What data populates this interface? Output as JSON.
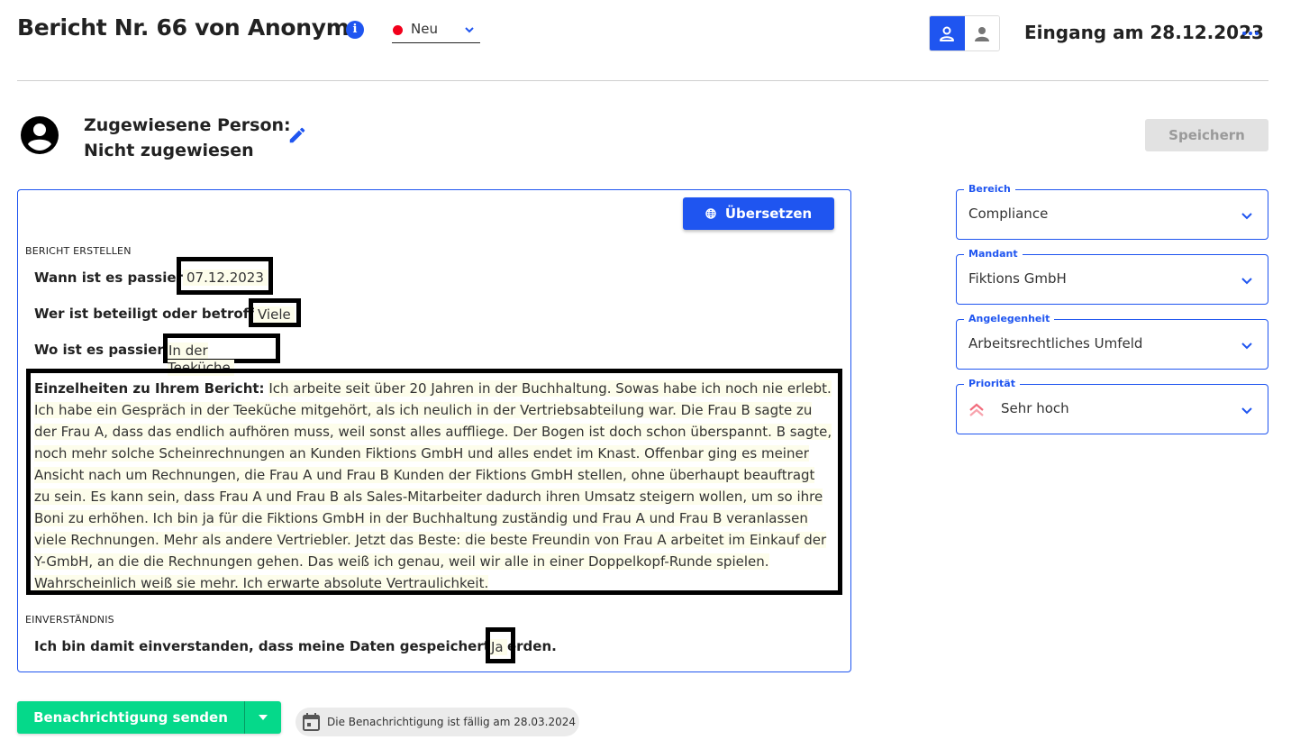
{
  "header": {
    "title": "Bericht Nr. 66 von Anonym",
    "info_icon": "info-icon",
    "status": {
      "label": "Neu",
      "color": "#f2001b"
    },
    "view_toggle": {
      "active": "person-outline-icon",
      "inactive": "person-filled-icon"
    },
    "received": "Eingang am 28.12.2023",
    "more_icon": "more-horizontal-icon"
  },
  "assignment": {
    "label_line1": "Zugewiesene Person:",
    "label_line2": "Nicht zugewiesen",
    "icon": "account-circle-icon",
    "edit_icon": "pencil-icon"
  },
  "toolbar": {
    "save_label": "Speichern",
    "translate_label": "Übersetzen"
  },
  "report": {
    "section_create": "BERICHT ERSTELLEN",
    "fields": [
      {
        "question": "Wann ist es passiert?",
        "answer": "07.12.2023"
      },
      {
        "question": "Wer ist beteiligt oder betroffen?",
        "answer": "Viele"
      },
      {
        "question": "Wo ist es passiert?:",
        "answer": "In der Teeküche"
      }
    ],
    "details_label": "Einzelheiten zu Ihrem Bericht:",
    "details_text": "Ich arbeite seit über 20 Jahren in der Buchhaltung. Sowas habe ich noch nie erlebt. Ich habe ein Gespräch in der Teeküche mitgehört, als ich neulich in der Vertriebsabteilung war. Die Frau B sagte zu der Frau A, dass das endlich aufhören muss, weil sonst alles auffliege. Der Bogen ist doch schon überspannt. B sagte, noch mehr solche Scheinrechnungen an Kunden Fiktions GmbH und alles endet im Knast. Offenbar ging es meiner Ansicht nach um Rechnungen, die Frau A und Frau B Kunden der Fiktions GmbH stellen, ohne überhaupt beauftragt zu sein. Es kann sein, dass Frau A und Frau B als Sales-Mitarbeiter dadurch ihren Umsatz steigern wollen, um so ihre Boni zu erhöhen. Ich bin ja für die Fiktions GmbH in der Buchhaltung zuständig und Frau A und Frau B veranlassen viele Rechnungen. Mehr als andere Vertriebler. Jetzt das Beste: die beste Freundin von Frau A arbeitet im Einkauf der Y-GmbH, an die die Rechnungen gehen. Das weiß ich genau, weil wir alle in einer Doppelkopf-Runde spielen. Wahrscheinlich weiß sie mehr. Ich erwarte absolute Vertraulichkeit.",
    "section_consent": "EINVERSTÄNDNIS",
    "consent_question": "Ich bin damit einverstanden, dass meine Daten gespeichert werden.",
    "consent_answer": "Ja"
  },
  "sidebar": {
    "fields": [
      {
        "label": "Bereich",
        "value": "Compliance"
      },
      {
        "label": "Mandant",
        "value": "Fiktions GmbH"
      },
      {
        "label": "Angelegenheit",
        "value": "Arbeitsrechtliches Umfeld"
      },
      {
        "label": "Priorität",
        "value": "Sehr hoch",
        "icon": "priority-highest-icon",
        "icon_color": "#f26d7d"
      }
    ]
  },
  "footer": {
    "notify_label": "Benachrichtigung senden",
    "due_text": "Die Benachrichtigung ist fällig am 28.03.2024",
    "due_icon": "calendar-icon"
  },
  "colors": {
    "primary": "#1f55f0",
    "success": "#05d98a",
    "status_new": "#f2001b",
    "highlight": "#fdfdeb"
  }
}
